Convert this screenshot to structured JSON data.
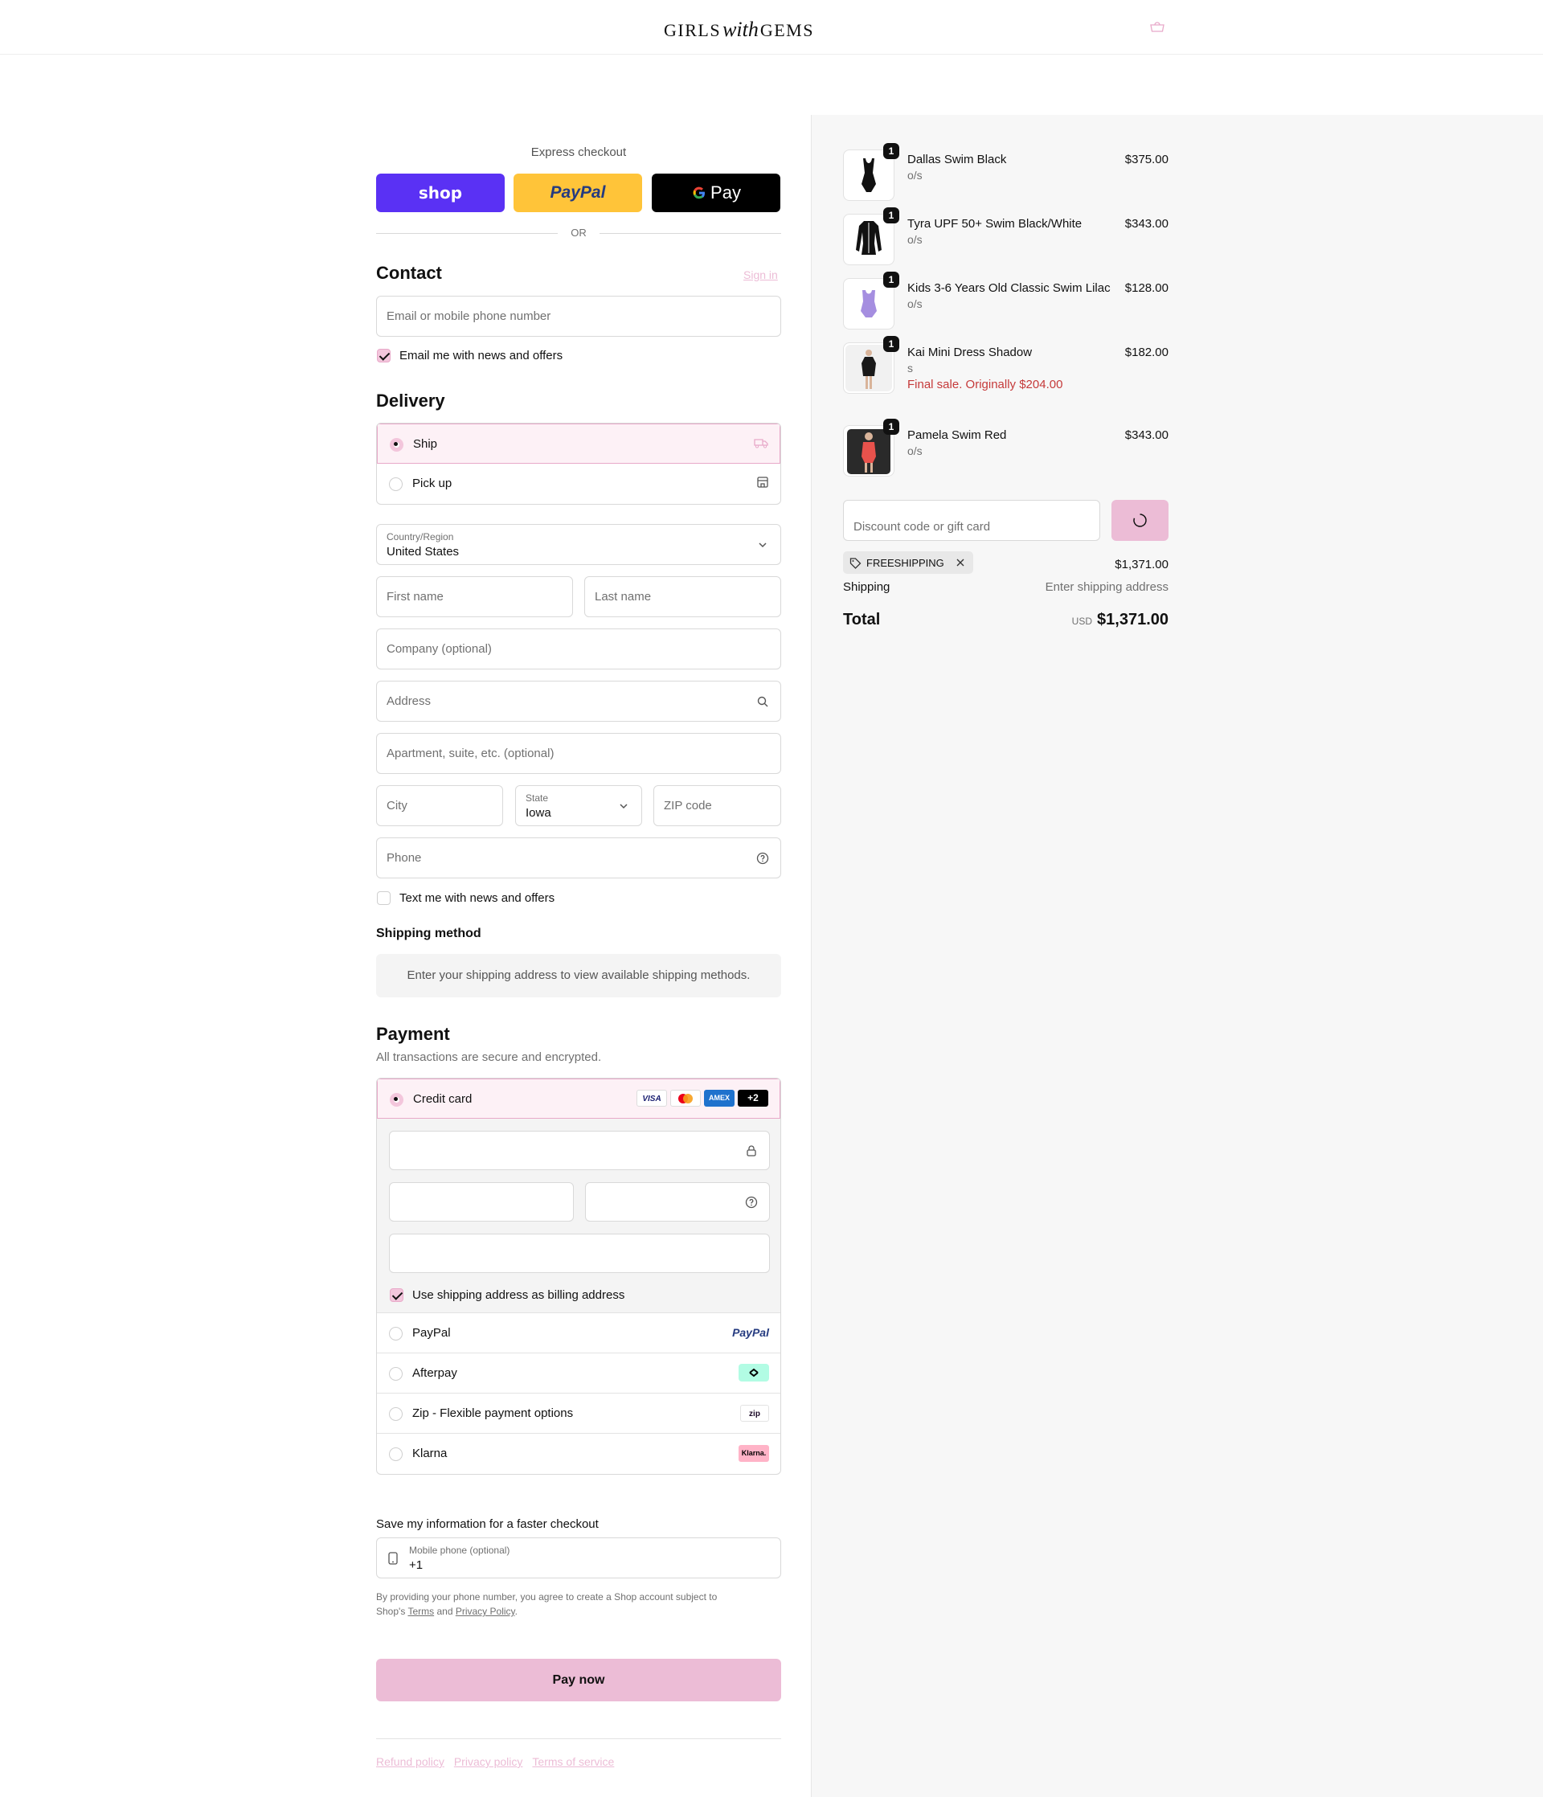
{
  "header": {
    "logo_text_left": "GIRLS",
    "logo_text_mid": "with",
    "logo_text_right": "GEMS",
    "cart_icon": "bag-icon"
  },
  "express": {
    "label": "Express checkout",
    "shop": "shop",
    "paypal": "PayPal",
    "gpay": "Pay",
    "or": "OR"
  },
  "contact": {
    "title": "Contact",
    "sign_in": "Sign in",
    "email_placeholder": "Email or mobile phone number",
    "news_label": "Email me with news and offers",
    "news_checked": true
  },
  "delivery": {
    "title": "Delivery",
    "options": [
      {
        "label": "Ship",
        "selected": true,
        "icon": "truck-icon"
      },
      {
        "label": "Pick up",
        "selected": false,
        "icon": "store-icon"
      }
    ],
    "country_label": "Country/Region",
    "country_value": "United States",
    "first_name": "First name",
    "last_name": "Last name",
    "company": "Company (optional)",
    "address": "Address",
    "apartment": "Apartment, suite, etc. (optional)",
    "city": "City",
    "state_label": "State",
    "state_value": "Iowa",
    "zip": "ZIP code",
    "phone": "Phone",
    "text_label": "Text me with news and offers"
  },
  "shipping_method": {
    "title": "Shipping method",
    "info": "Enter your shipping address to view available shipping methods."
  },
  "payment": {
    "title": "Payment",
    "subtitle": "All transactions are secure and encrypted.",
    "credit_card": "Credit card",
    "more_cards": "+2",
    "brands": [
      "VISA",
      "mastercard",
      "AMEX"
    ],
    "billing_same": "Use shipping address as billing address",
    "options": [
      {
        "label": "PayPal",
        "logo": "PayPal"
      },
      {
        "label": "Afterpay",
        "logo": "afterpay-icon"
      },
      {
        "label": "Zip - Flexible payment options",
        "logo": "zip"
      },
      {
        "label": "Klarna",
        "logo": "Klarna."
      }
    ]
  },
  "save": {
    "title": "Save my information for a faster checkout",
    "mobile_label": "Mobile phone (optional)",
    "mobile_value": "+1",
    "disclaimer_1": "By providing your phone number, you agree to create a Shop account subject to",
    "disclaimer_2": "Shop's",
    "terms": "Terms",
    "and": "and",
    "privacy": "Privacy Policy",
    "period": "."
  },
  "pay_now": "Pay now",
  "footer_links": [
    "Refund policy",
    "Privacy policy",
    "Terms of service"
  ],
  "cart": {
    "items": [
      {
        "name": "Dallas Swim Black",
        "variant": "o/s",
        "price": "$375.00",
        "qty": "1",
        "color": "#111111"
      },
      {
        "name": "Tyra UPF 50+ Swim Black/White",
        "variant": "o/s",
        "price": "$343.00",
        "qty": "1",
        "color": "#111111"
      },
      {
        "name": "Kids 3-6 Years Old Classic Swim Lilac",
        "variant": "o/s",
        "price": "$128.00",
        "qty": "1",
        "color": "#a58ee0"
      },
      {
        "name": "Kai Mini Dress Shadow",
        "variant": "s",
        "price": "$182.00",
        "qty": "1",
        "sale": "Final sale. Originally $204.00",
        "color": "#1a1a1a"
      },
      {
        "name": "Pamela Swim Red",
        "variant": "o/s",
        "price": "$343.00",
        "qty": "1",
        "color": "#e8524c"
      }
    ],
    "discount_placeholder": "Discount code or gift card",
    "discount_tag": "FREESHIPPING",
    "subtotal": "$1,371.00",
    "shipping_label": "Shipping",
    "shipping_value": "Enter shipping address",
    "total_label": "Total",
    "currency": "USD",
    "total": "$1,371.00"
  },
  "colors": {
    "accent": "#ecbcd6",
    "shop": "#5a31f4",
    "paypal": "#ffc439",
    "sale": "#c53a3a"
  }
}
